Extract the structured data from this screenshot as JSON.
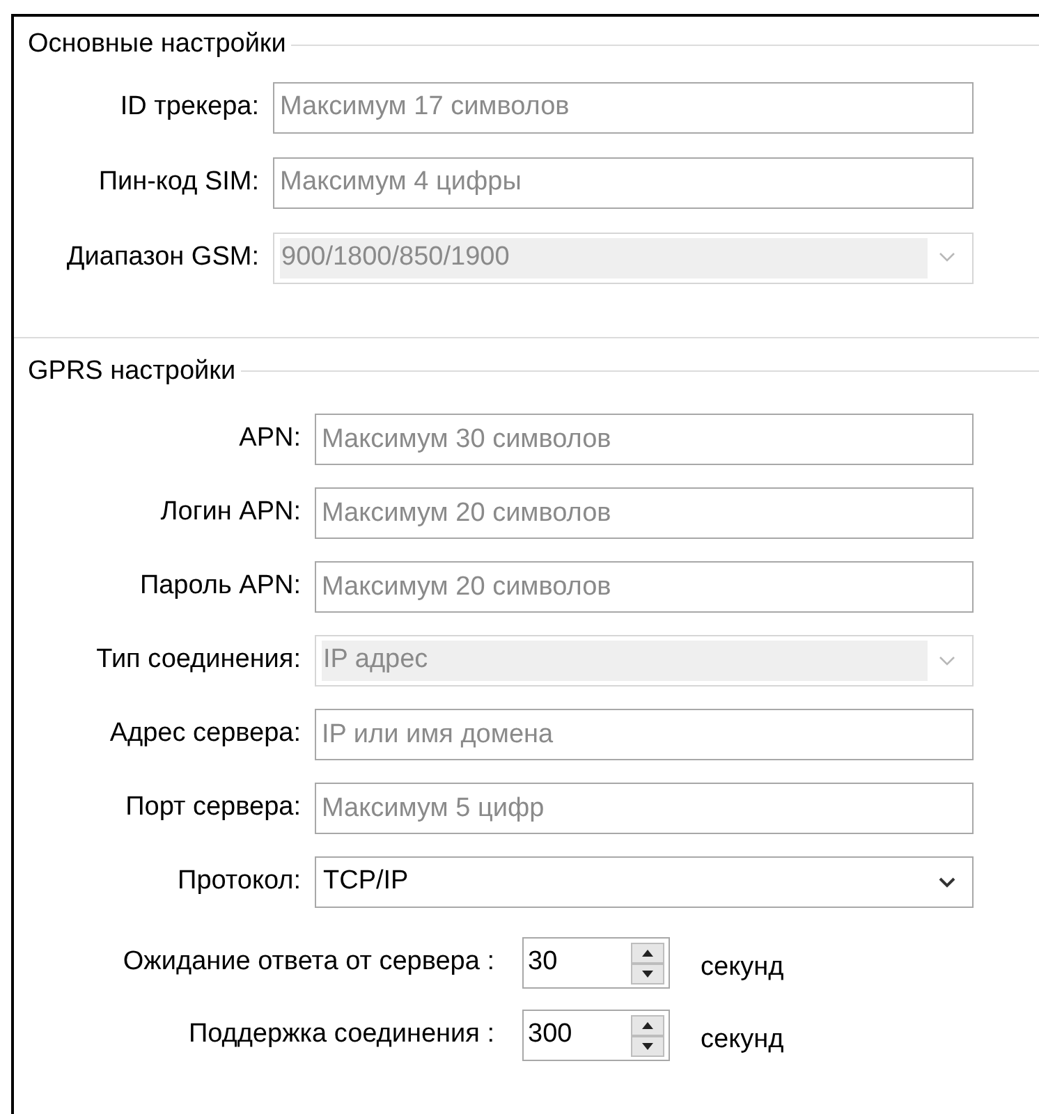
{
  "sections": [
    {
      "title": "Основные настройки",
      "fields": [
        {
          "kind": "text",
          "label": "ID трекера:",
          "placeholder": "Максимум 17 символов"
        },
        {
          "kind": "text",
          "label": "Пин-код SIM:",
          "placeholder": "Максимум 4 цифры"
        },
        {
          "kind": "select",
          "label": "Диапазон GSM:",
          "value": "900/1800/850/1900",
          "disabled": true
        }
      ]
    },
    {
      "title": "GPRS настройки",
      "fields": [
        {
          "kind": "text",
          "label": "APN:",
          "placeholder": "Максимум 30 символов"
        },
        {
          "kind": "text",
          "label": "Логин APN:",
          "placeholder": "Максимум 20 символов"
        },
        {
          "kind": "text",
          "label": "Пароль APN:",
          "placeholder": "Максимум 20 символов"
        },
        {
          "kind": "select",
          "label": "Тип соединения:",
          "value": "IP адрес",
          "disabled": true
        },
        {
          "kind": "text",
          "label": "Адрес сервера:",
          "placeholder": "IP или имя домена"
        },
        {
          "kind": "text",
          "label": "Порт сервера:",
          "placeholder": "Максимум 5 цифр"
        },
        {
          "kind": "select",
          "label": "Протокол:",
          "value": "TCP/IP",
          "disabled": false
        }
      ],
      "spinners": [
        {
          "label": "Ожидание ответа от сервера :",
          "value": "30",
          "unit": "секунд"
        },
        {
          "label": "Поддержка соединения :",
          "value": "300",
          "unit": "секунд"
        }
      ]
    }
  ]
}
